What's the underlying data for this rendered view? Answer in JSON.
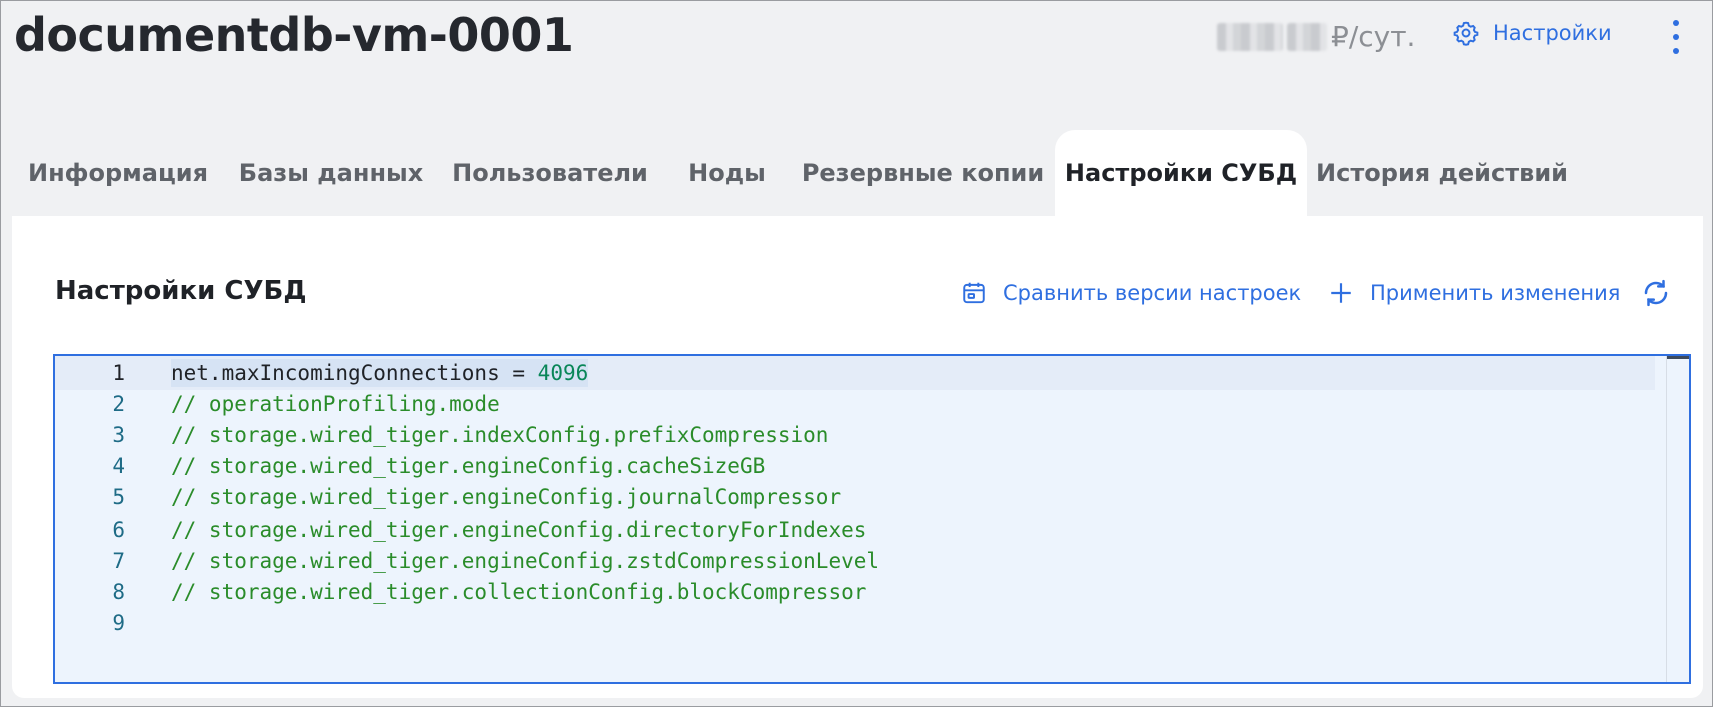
{
  "header": {
    "title": "documentdb-vm-0001",
    "price_suffix": "₽/сут.",
    "settings_label": "Настройки"
  },
  "tabs": [
    {
      "label": "Информация",
      "active": false
    },
    {
      "label": "Базы данных",
      "active": false
    },
    {
      "label": "Пользователи",
      "active": false
    },
    {
      "label": "Ноды",
      "active": false
    },
    {
      "label": "Резервные копии",
      "active": false
    },
    {
      "label": "Настройки СУБД",
      "active": true
    },
    {
      "label": "История действий",
      "active": false
    }
  ],
  "panel": {
    "title": "Настройки СУБД",
    "compare_label": "Сравнить версии настроек",
    "apply_label": "Применить изменения"
  },
  "editor": {
    "lines": [
      {
        "n": "1",
        "key": "net.maxIncomingConnections",
        "op": " = ",
        "value": "4096"
      },
      {
        "n": "2",
        "comment": "// operationProfiling.mode"
      },
      {
        "n": "3",
        "comment": "// storage.wired_tiger.indexConfig.prefixCompression"
      },
      {
        "n": "4",
        "comment": "// storage.wired_tiger.engineConfig.cacheSizeGB"
      },
      {
        "n": "5",
        "comment": "// storage.wired_tiger.engineConfig.journalCompressor"
      },
      {
        "n": "6",
        "comment": "// storage.wired_tiger.engineConfig.directoryForIndexes"
      },
      {
        "n": "7",
        "comment": "// storage.wired_tiger.engineConfig.zstdCompressionLevel"
      },
      {
        "n": "8",
        "comment": "// storage.wired_tiger.collectionConfig.blockCompressor"
      },
      {
        "n": "9",
        "comment": ""
      }
    ]
  },
  "colors": {
    "accent": "#2f6fe0",
    "comment": "#2a8c2a",
    "number": "#098658",
    "line_number": "#1e6b86"
  },
  "icons": {
    "settings": "gear-icon",
    "more": "more-vertical-icon",
    "compare": "calendar-icon",
    "apply": "plus-icon",
    "refresh": "refresh-icon"
  }
}
